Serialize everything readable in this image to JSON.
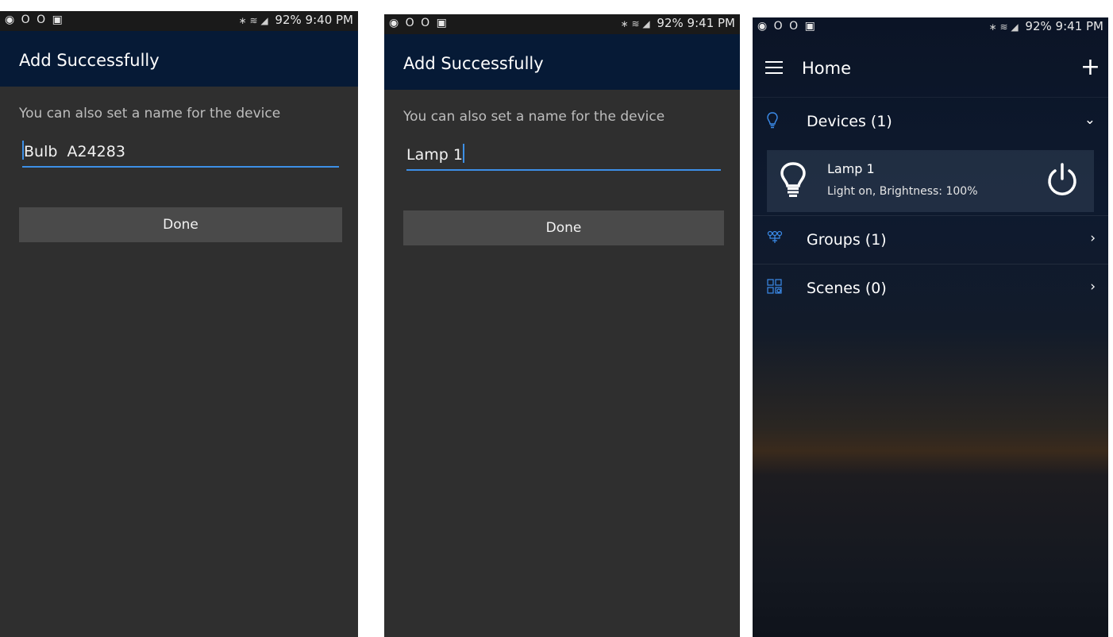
{
  "screens": [
    {
      "status": {
        "left_icons": "◉ O O ▣",
        "right_icons": "∗ ≋ ◢",
        "battery": "92%",
        "time": "9:40 PM"
      },
      "title": "Add Successfully",
      "prompt": "You can also set a name for the device",
      "name_value": "Bulb  A24283",
      "done_label": "Done"
    },
    {
      "status": {
        "left_icons": "◉ O O ▣",
        "right_icons": "∗ ≋ ◢",
        "battery": "92%",
        "time": "9:41 PM"
      },
      "title": "Add Successfully",
      "prompt": "You can also set a name for the device",
      "name_value": "Lamp 1",
      "done_label": "Done"
    },
    {
      "status": {
        "left_icons": "◉ O O ▣",
        "right_icons": "∗ ≋ ◢",
        "battery": "92%",
        "time": "9:41 PM"
      },
      "title": "Home",
      "devices_label": "Devices (1)",
      "device": {
        "name": "Lamp 1",
        "status": "Light on, Brightness: 100%"
      },
      "groups_label": "Groups (1)",
      "scenes_label": "Scenes (0)"
    }
  ],
  "icons": {
    "menu": "hamburger-menu-icon",
    "add": "plus-icon",
    "devices": "lightbulb-outline-icon",
    "groups": "group-nodes-icon",
    "scenes": "scenes-grid-icon",
    "power": "power-icon"
  },
  "colors": {
    "appbar": "#061a36",
    "accent": "#3d8fe6",
    "screen_bg": "#2f2f2f",
    "button": "#4a4a4a"
  }
}
